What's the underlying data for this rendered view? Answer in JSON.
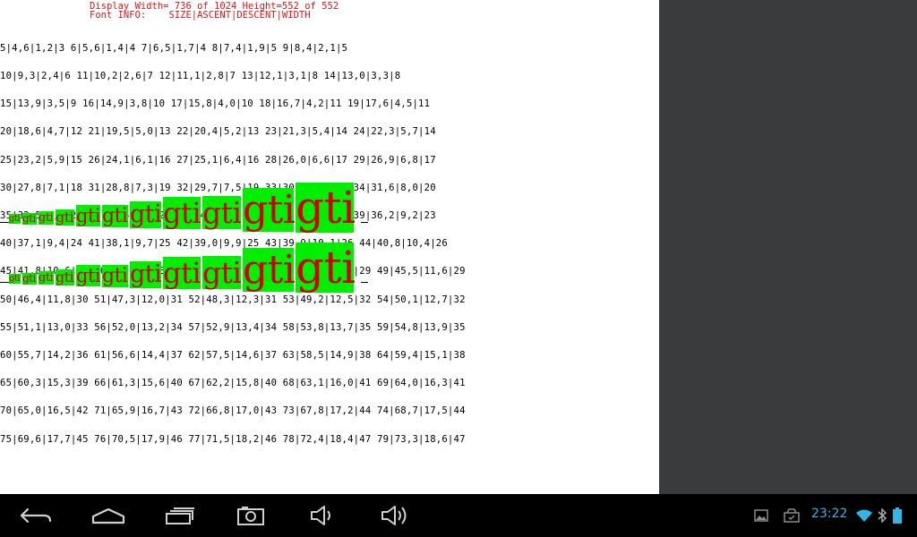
{
  "screen": {
    "header_line1": "Display Width= 736 of 1024 Height=552 of 552",
    "header_line2": "Font INFO:    SIZE|ASCENT|DESCENT|WIDTH"
  },
  "font_table": [
    "5|4,6|1,2|3 6|5,6|1,4|4 7|6,5|1,7|4 8|7,4|1,9|5 9|8,4|2,1|5",
    "10|9,3|2,4|6 11|10,2|2,6|7 12|11,1|2,8|7 13|12,1|3,1|8 14|13,0|3,3|8",
    "15|13,9|3,5|9 16|14,9|3,8|10 17|15,8|4,0|10 18|16,7|4,2|11 19|17,6|4,5|11",
    "20|18,6|4,7|12 21|19,5|5,0|13 22|20,4|5,2|13 23|21,3|5,4|14 24|22,3|5,7|14",
    "25|23,2|5,9|15 26|24,1|6,1|16 27|25,1|6,4|16 28|26,0|6,6|17 29|26,9|6,8|17",
    "30|27,8|7,1|18 31|28,8|7,3|19 32|29,7|7,5|19 33|30,6|7,8|20 34|31,6|8,0|20",
    "35|32,5|8,3|21 36|33,4|8,5|22 37|34,3|8,7|22 38|35,3|9,0|23 39|36,2|9,2|23",
    "40|37,1|9,4|24 41|38,1|9,7|25 42|39,0|9,9|25 43|39,9|10,1|26 44|40,8|10,4|26",
    "45|41,8|10,6|27 46|42,7|10,8|28 47|43,6|11,1|28 48|44,6|11,3|29 49|45,5|11,6|29",
    "50|46,4|11,8|30 51|47,3|12,0|31 52|48,3|12,3|31 53|49,2|12,5|32 54|50,1|12,7|32",
    "55|51,1|13,0|33 56|52,0|13,2|34 57|52,9|13,4|34 58|53,8|13,7|35 59|54,8|13,9|35",
    "60|55,7|14,2|36 61|56,6|14,4|37 62|57,5|14,6|37 63|58,5|14,9|38 64|59,4|15,1|38",
    "65|60,3|15,3|39 66|61,3|15,6|40 67|62,2|15,8|40 68|63,1|16,0|41 69|64,0|16,3|41",
    "70|65,0|16,5|42 71|65,9|16,7|43 72|66,8|17,0|43 73|67,8|17,2|44 74|68,7|17,5|44",
    "75|69,6|17,7|45 76|70,5|17,9|46 77|71,5|18,2|46 78|72,4|18,4|47 79|73,3|18,6|47"
  ],
  "sample_text": "gti",
  "sample_rows": 2,
  "sample_sizes": [
    10,
    12,
    13,
    16,
    21,
    22,
    27,
    32,
    33,
    44,
    50
  ],
  "colors": {
    "sample_bg": "#00ee00",
    "sample_fg": "#d00000",
    "header_fg": "#d81818",
    "clock_fg": "#33b5e5",
    "side_panel": "#3a3b3d"
  },
  "navbar": {
    "buttons": [
      "back-icon",
      "home-icon",
      "recent-apps-icon",
      "screenshot-icon",
      "volume-down-icon",
      "volume-up-icon"
    ],
    "status_icons": [
      "gallery-notification-icon",
      "storage-notification-icon",
      "wifi-icon",
      "bluetooth-icon",
      "battery-icon"
    ],
    "clock": "23:22"
  }
}
